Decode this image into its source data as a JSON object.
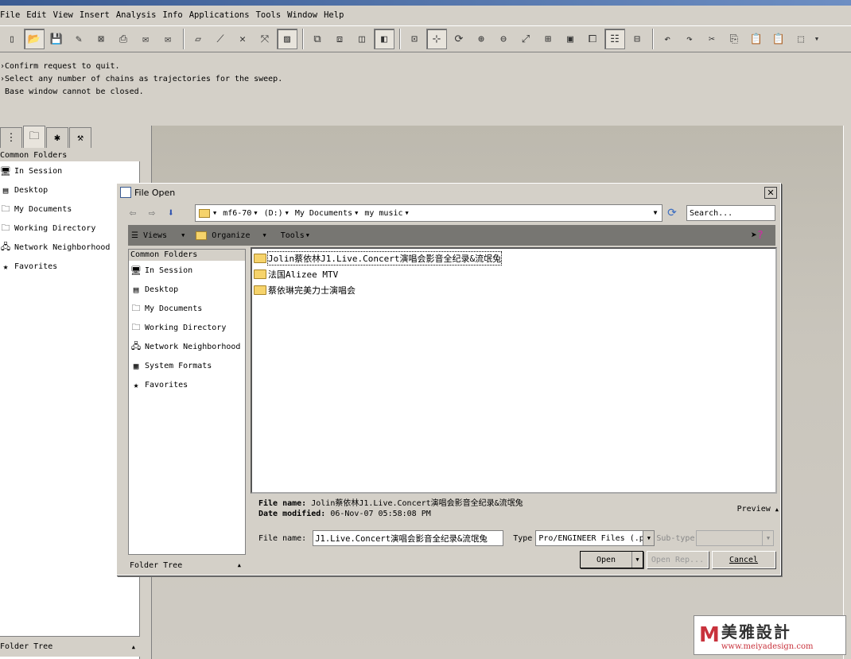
{
  "menubar": {
    "items": [
      "File",
      "Edit",
      "View",
      "Insert",
      "Analysis",
      "Info",
      "Applications",
      "Tools",
      "Window",
      "Help"
    ]
  },
  "messages": [
    "Confirm request to quit.",
    "Select any number of chains as trajectories for the sweep.",
    "Base window cannot be closed."
  ],
  "navigator": {
    "header": "Common Folders",
    "items": [
      "In Session",
      "Desktop",
      "My Documents",
      "Working Directory",
      "Network Neighborhood",
      "Favorites"
    ],
    "footer": "Folder Tree"
  },
  "dialog": {
    "title": "File Open",
    "path": {
      "crumbs": [
        "mf6-70",
        "(D:)",
        "My Documents",
        "my music"
      ]
    },
    "search": {
      "placeholder": "Search..."
    },
    "toolbar": {
      "views": "Views",
      "organize": "Organize",
      "tools": "Tools"
    },
    "common_folders": {
      "header": "Common Folders",
      "items": [
        "In Session",
        "Desktop",
        "My Documents",
        "Working Directory",
        "Network Neighborhood",
        "System Formats",
        "Favorites"
      ],
      "footer": "Folder Tree"
    },
    "files": [
      "Jolin蔡依林J1.Live.Concert演唱会影音全纪录&流氓兔",
      "法国Alizee MTV",
      "蔡依琳完美力士演唱会"
    ],
    "info": {
      "file_name_label": "File name:",
      "file_name_value": "Jolin蔡依林J1.Live.Concert演唱会影音全纪录&流氓兔",
      "date_label": "Date modified:",
      "date_value": "06-Nov-07 05:58:08 PM",
      "preview": "Preview"
    },
    "filename_field": {
      "label": "File name:",
      "value": "J1.Live.Concert演唱会影音全纪录&流氓兔"
    },
    "type_field": {
      "label": "Type",
      "value": "Pro/ENGINEER Files (.prt,.asm,...)"
    },
    "subtype_label": "Sub-type",
    "buttons": {
      "open": "Open",
      "open_rep": "Open Rep...",
      "cancel": "Cancel"
    }
  },
  "watermark": {
    "logo": "M",
    "name": "美雅設計",
    "url": "www.meiyadesign.com"
  }
}
